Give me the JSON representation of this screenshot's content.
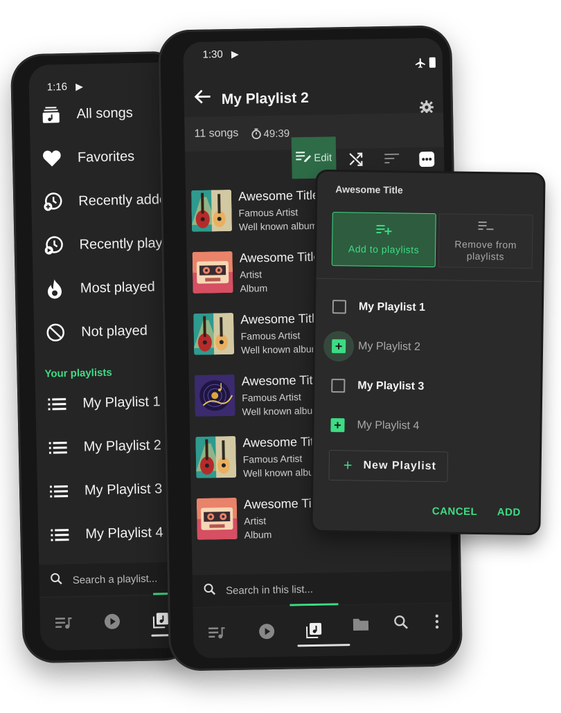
{
  "back_screen": {
    "status_time": "1:16",
    "menu": [
      {
        "icon": "library-music-icon",
        "label": "All songs"
      },
      {
        "icon": "heart-icon",
        "label": "Favorites"
      },
      {
        "icon": "recently-added-icon",
        "label": "Recently added"
      },
      {
        "icon": "history-icon",
        "label": "Recently played"
      },
      {
        "icon": "flame-icon",
        "label": "Most played"
      },
      {
        "icon": "block-icon",
        "label": "Not played"
      }
    ],
    "playlists_header": "Your playlists",
    "playlists": [
      "My Playlist 1",
      "My Playlist 2",
      "My Playlist 3",
      "My Playlist 4"
    ],
    "search_placeholder": "Search a playlist..."
  },
  "front_screen": {
    "status_time": "1:30",
    "title": "My Playlist 2",
    "song_count": "11 songs",
    "duration": "49:39",
    "edit_label": "Edit",
    "songs": [
      {
        "title": "Awesome Title",
        "artist": "Famous Artist",
        "album": "Well known album",
        "art": "guitar"
      },
      {
        "title": "Awesome Title",
        "artist": "Artist",
        "album": "Album",
        "art": "cassette"
      },
      {
        "title": "Awesome Title",
        "artist": "Famous Artist",
        "album": "Well known album",
        "art": "guitar"
      },
      {
        "title": "Awesome Title",
        "artist": "Famous Artist",
        "album": "Well known album",
        "art": "vinyl"
      },
      {
        "title": "Awesome Title",
        "artist": "Famous Artist",
        "album": "Well known album",
        "art": "guitar"
      },
      {
        "title": "Awesome Title",
        "artist": "Artist",
        "album": "Album",
        "art": "cassette"
      }
    ],
    "search_placeholder": "Search in this list..."
  },
  "dialog": {
    "title": "Awesome Title",
    "add_to_playlists": "Add to playlists",
    "remove_from_playlists_1": "Remove from",
    "remove_from_playlists_2": "playlists",
    "playlists": [
      {
        "label": "My Playlist 1",
        "state": "unchecked"
      },
      {
        "label": "My Playlist 2",
        "state": "added"
      },
      {
        "label": "My Playlist 3",
        "state": "unchecked"
      },
      {
        "label": "My Playlist 4",
        "state": "added"
      }
    ],
    "new_playlist": "New Playlist",
    "cancel": "CANCEL",
    "add": "ADD"
  },
  "colors": {
    "accent": "#3ddc84",
    "background": "#252525"
  }
}
